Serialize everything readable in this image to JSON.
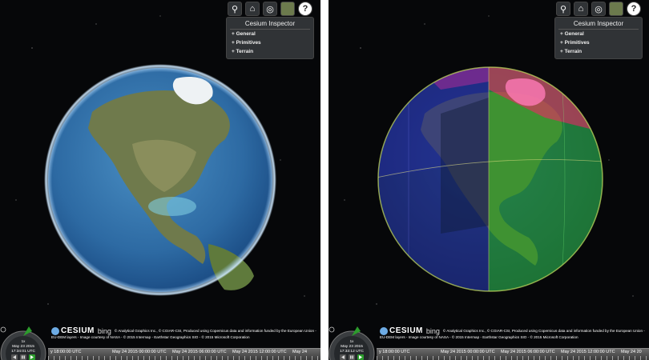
{
  "panels": [
    {
      "id": "left",
      "toolbar": {
        "buttons": [
          "search-icon",
          "home-icon",
          "globe-icon",
          "layers-icon",
          "help-icon"
        ],
        "help_label": "?"
      },
      "inspector": {
        "title": "Cesium Inspector",
        "sections": [
          "+ General",
          "+ Primitives",
          "+ Terrain"
        ]
      },
      "clock": {
        "speed": "1x",
        "date": "May 23 2015",
        "time": "17:34:01 UTC"
      },
      "credits": {
        "logo": "CESIUM",
        "bing": "bing",
        "text": "© Analytical Graphics Inc., © CGIAR-CSI, Produced using Copernicus data and information funded by the European Union - EU-DEM layers - Image courtesy of NASA - © 2015 Intermap - Earthstar Geographics SIO - © 2015 Microsoft Corporation"
      },
      "timeline": [
        "y 18:00:00 UTC",
        "May 24 2015 00:00:00 UTC",
        "May 24 2015 06:00:00 UTC",
        "May 24 2015 12:00:00 UTC",
        "May 24"
      ]
    },
    {
      "id": "right",
      "toolbar": {
        "buttons": [
          "search-icon",
          "home-icon",
          "globe-icon",
          "layers-icon",
          "help-icon"
        ],
        "help_label": "?"
      },
      "inspector": {
        "title": "Cesium Inspector",
        "sections": [
          "+ General",
          "+ Primitives",
          "+ Terrain"
        ]
      },
      "clock": {
        "speed": "1x",
        "date": "May 23 2015",
        "time": "17:33:12 UTC"
      },
      "credits": {
        "logo": "CESIUM",
        "bing": "bing",
        "text": "© Analytical Graphics Inc., © CGIAR-CSI, Produced using Copernicus data and information funded by the European Union - EU-DEM layers - Image courtesy of NASA - © 2015 Intermap - Earthstar Geographics SIO - © 2015 Microsoft Corporation"
      },
      "timeline": [
        "y 18:00:00 UTC",
        "May 24 2015 00:00:00 UTC",
        "May 24 2015 06:00:00 UTC",
        "May 24 2015 12:00:00 UTC",
        "May 24 20"
      ]
    }
  ],
  "colors": {
    "space": "#060709",
    "ocean": "#2f6fa8",
    "ui_panel": "#303336",
    "tile_blue": "#2a2aa8",
    "tile_green": "#33c433",
    "tile_red": "#ff2266"
  }
}
